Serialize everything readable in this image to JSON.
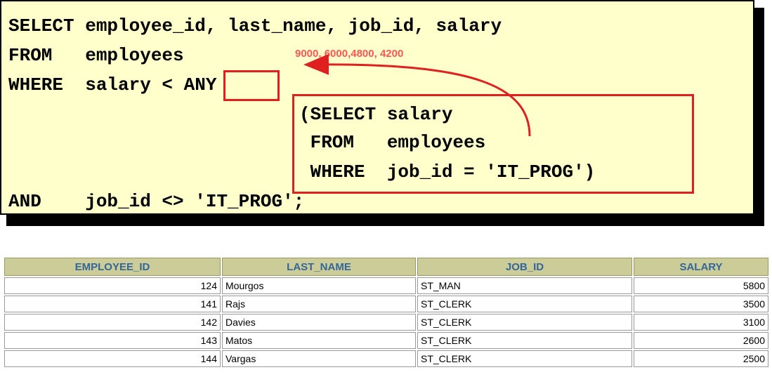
{
  "sql": {
    "line1": "SELECT employee_id, last_name, job_id, salary",
    "line2": "FROM   employees",
    "line3_prefix": "WHERE  salary < ",
    "line3_keyword": "ANY",
    "sub1": "(SELECT salary",
    "sub2": " FROM   employees",
    "sub3": " WHERE  job_id = 'IT_PROG')",
    "line_last": "AND    job_id <> 'IT_PROG';"
  },
  "annotation": "9000, 6000,4800, 4200",
  "colors": {
    "panel_bg": "#ffffcc",
    "highlight_red": "#e02020",
    "annotation_red": "#ff5555",
    "header_bg": "#cccc99",
    "header_text": "#336699"
  },
  "table": {
    "headers": [
      "EMPLOYEE_ID",
      "LAST_NAME",
      "JOB_ID",
      "SALARY"
    ],
    "rows": [
      {
        "employee_id": "124",
        "last_name": "Mourgos",
        "job_id": "ST_MAN",
        "salary": "5800"
      },
      {
        "employee_id": "141",
        "last_name": "Rajs",
        "job_id": "ST_CLERK",
        "salary": "3500"
      },
      {
        "employee_id": "142",
        "last_name": "Davies",
        "job_id": "ST_CLERK",
        "salary": "3100"
      },
      {
        "employee_id": "143",
        "last_name": "Matos",
        "job_id": "ST_CLERK",
        "salary": "2600"
      },
      {
        "employee_id": "144",
        "last_name": "Vargas",
        "job_id": "ST_CLERK",
        "salary": "2500"
      }
    ]
  }
}
